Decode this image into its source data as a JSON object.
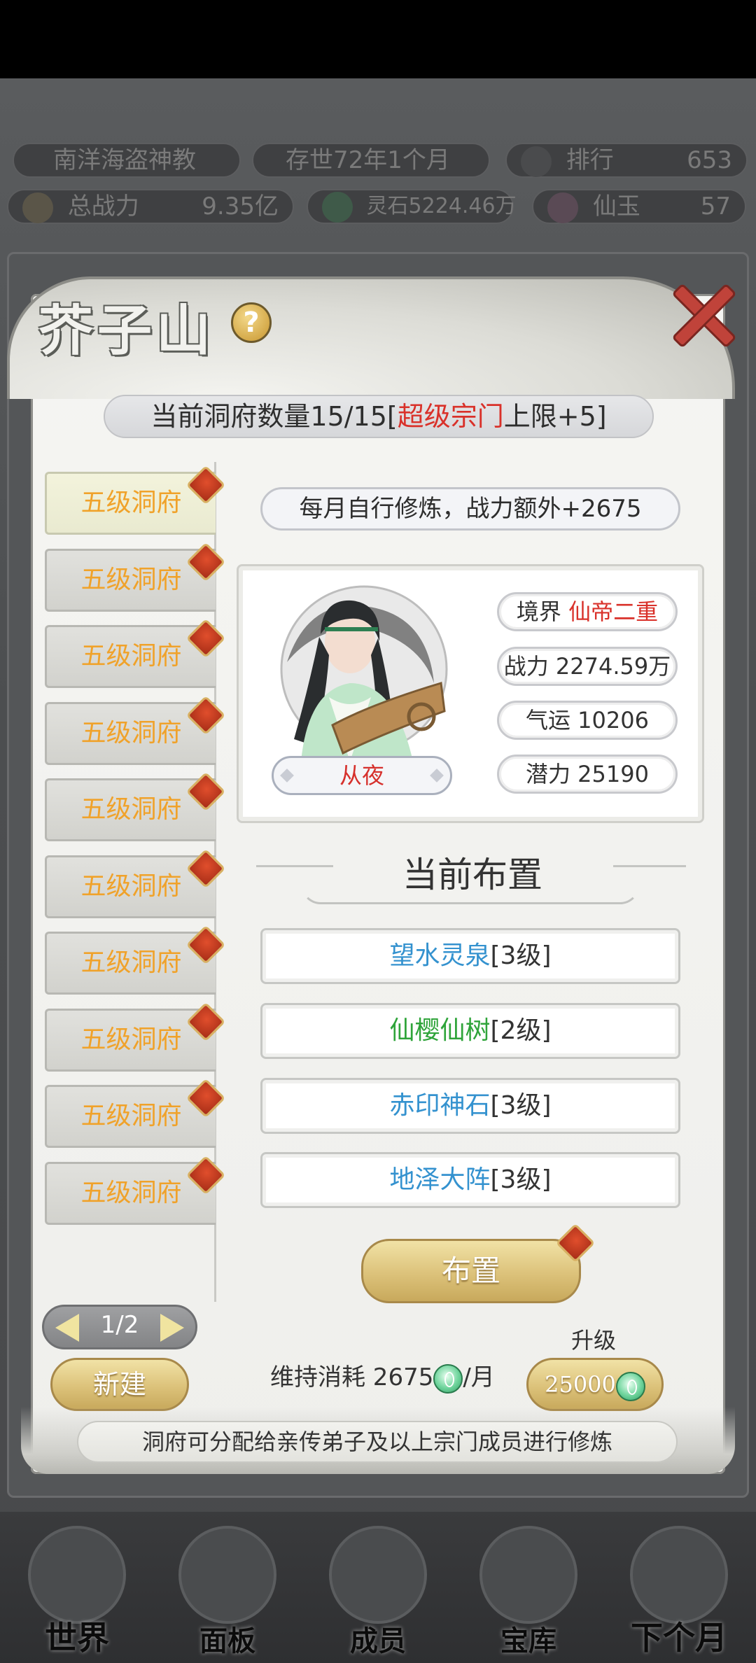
{
  "background": {
    "sect_name": "南洋海盗神教",
    "age": "存世72年1个月",
    "rank_label": "排行",
    "rank_value": "653",
    "power_label": "总战力",
    "power_value": "9.35亿",
    "spirit_stone": "灵石5224.46万",
    "jade_label": "仙玉",
    "jade_value": "57",
    "nav": [
      "世界",
      "面板",
      "成员",
      "宝库",
      "下个月"
    ]
  },
  "panel": {
    "title": "芥子山",
    "help": "?",
    "count_prefix": "当前洞府数量15/15[",
    "count_highlight": "超级宗门",
    "count_suffix": "上限+5]",
    "caves": [
      "五级洞府",
      "五级洞府",
      "五级洞府",
      "五级洞府",
      "五级洞府",
      "五级洞府",
      "五级洞府",
      "五级洞府",
      "五级洞府",
      "五级洞府"
    ],
    "pager": "1/2",
    "new_button": "新建",
    "bonus": "每月自行修炼，战力额外+2675",
    "character": {
      "name": "从夜",
      "realm_label": "境界",
      "realm_value": "仙帝二重",
      "power": "战力 2274.59万",
      "luck": "气运 10206",
      "potential": "潜力 25190"
    },
    "section_title": "当前布置",
    "slots": [
      {
        "name": "望水灵泉",
        "level": "[3级]",
        "color": "#3492cf"
      },
      {
        "name": "仙樱仙树",
        "level": "[2级]",
        "color": "#2fa43a"
      },
      {
        "name": "赤印神石",
        "level": "[3级]",
        "color": "#3492cf"
      },
      {
        "name": "地泽大阵",
        "level": "[3级]",
        "color": "#3492cf"
      }
    ],
    "arrange_button": "布置",
    "upgrade_label": "升级",
    "upkeep_prefix": "维持消耗 2675",
    "upkeep_suffix": "/月",
    "upgrade_cost": "25000",
    "footer_note": "洞府可分配给亲传弟子及以上宗门成员进行修炼"
  },
  "colors": {
    "accent_gold": "#dcc27a",
    "cave_text": "#f0a22a",
    "highlight_red": "#d9312a"
  }
}
